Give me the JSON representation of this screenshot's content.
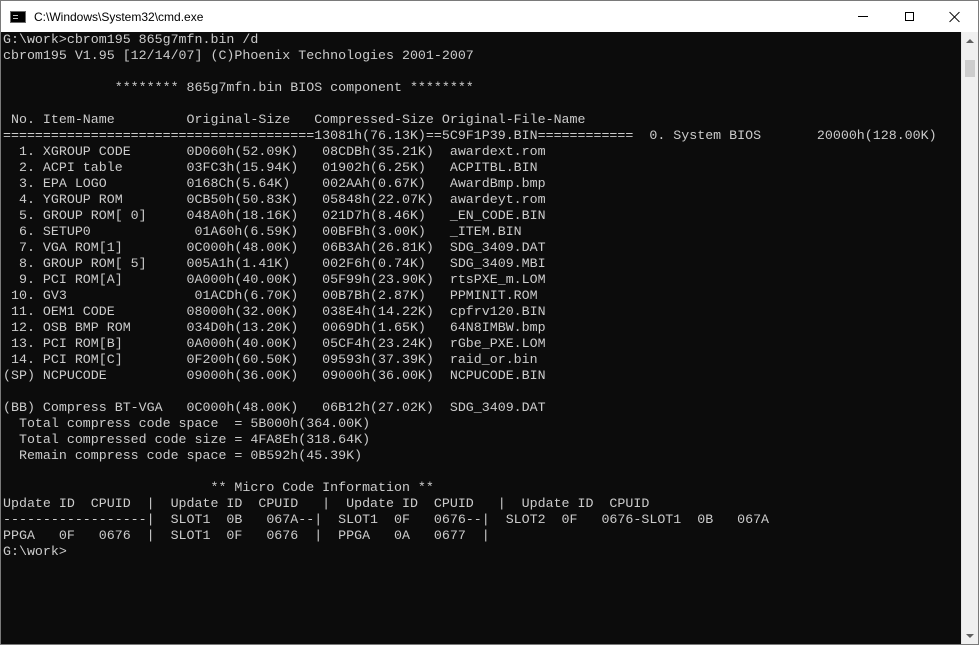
{
  "window": {
    "title": "C:\\Windows\\System32\\cmd.exe",
    "icon": "console-app-icon",
    "controls": [
      "minimize-icon",
      "maximize-icon",
      "close-icon"
    ]
  },
  "console": {
    "lines": [
      "G:\\work>cbrom195 865g7mfn.bin /d",
      "cbrom195 V1.95 [12/14/07] (C)Phoenix Technologies 2001-2007",
      "",
      "              ******** 865g7mfn.bin BIOS component ********",
      "",
      " No. Item-Name         Original-Size   Compressed-Size Original-File-Name",
      "=======================================13081h(76.13K)==5C9F1P39.BIN============  0. System BIOS       20000h(128.00K)",
      "  1. XGROUP CODE       0D060h(52.09K)   08CDBh(35.21K)  awardext.rom",
      "  2. ACPI table        03FC3h(15.94K)   01902h(6.25K)   ACPITBL.BIN",
      "  3. EPA LOGO          0168Ch(5.64K)    002AAh(0.67K)   AwardBmp.bmp",
      "  4. YGROUP ROM        0CB50h(50.83K)   05848h(22.07K)  awardeyt.rom",
      "  5. GROUP ROM[ 0]     048A0h(18.16K)   021D7h(8.46K)   _EN_CODE.BIN",
      "  6. SETUP0             01A60h(6.59K)   00BFBh(3.00K)   _ITEM.BIN",
      "  7. VGA ROM[1]        0C000h(48.00K)   06B3Ah(26.81K)  SDG_3409.DAT",
      "  8. GROUP ROM[ 5]     005A1h(1.41K)    002F6h(0.74K)   SDG_3409.MBI",
      "  9. PCI ROM[A]        0A000h(40.00K)   05F99h(23.90K)  rtsPXE_m.LOM",
      " 10. GV3                01ACDh(6.70K)   00B7Bh(2.87K)   PPMINIT.ROM",
      " 11. OEM1 CODE         08000h(32.00K)   038E4h(14.22K)  cpfrv120.BIN",
      " 12. OSB BMP ROM       034D0h(13.20K)   0069Dh(1.65K)   64N8IMBW.bmp",
      " 13. PCI ROM[B]        0A000h(40.00K)   05CF4h(23.24K)  rGbe_PXE.LOM",
      " 14. PCI ROM[C]        0F200h(60.50K)   09593h(37.39K)  raid_or.bin",
      "(SP) NCPUCODE          09000h(36.00K)   09000h(36.00K)  NCPUCODE.BIN",
      "",
      "(BB) Compress BT-VGA   0C000h(48.00K)   06B12h(27.02K)  SDG_3409.DAT",
      "  Total compress code space  = 5B000h(364.00K)",
      "  Total compressed code size = 4FA8Eh(318.64K)",
      "  Remain compress code space = 0B592h(45.39K)",
      "",
      "                          ** Micro Code Information **",
      "Update ID  CPUID  |  Update ID  CPUID   |  Update ID  CPUID   |  Update ID  CPUID",
      "------------------|  SLOT1  0B   067A--|  SLOT1  0F   0676--|  SLOT2  0F   0676-SLOT1  0B   067A",
      "PPGA   0F   0676  |  SLOT1  0F   0676  |  PPGA   0A   0677  |",
      "G:\\work>"
    ]
  },
  "colors": {
    "console_bg": "#0c0c0c",
    "console_fg": "#cccccc",
    "titlebar_bg": "#ffffff"
  }
}
